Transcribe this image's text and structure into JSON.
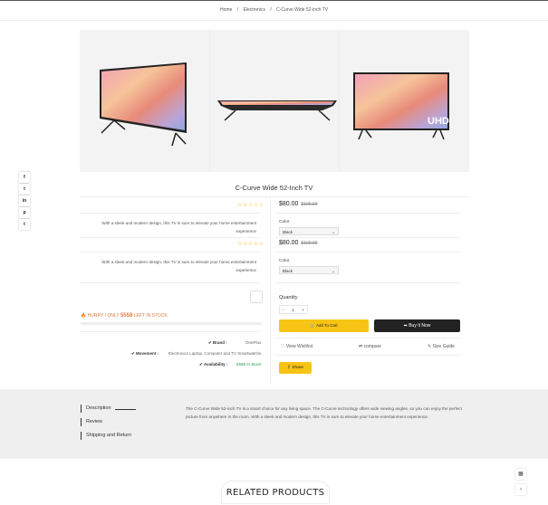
{
  "breadcrumb": {
    "home": "Home",
    "sep": "/",
    "category": "Electronics",
    "current": "C-Curve Wide 52-inch TV"
  },
  "gallery": {
    "uhd_badge": "UHD"
  },
  "social": [
    "f",
    "t",
    "in",
    "p",
    "t"
  ],
  "product": {
    "title": "C-Curve Wide 52-Inch TV",
    "stars": "☆☆☆☆☆",
    "description": "With a sleek and modern design, this TV is sure to elevate your home entertainment experience",
    "price": "$80.00",
    "old_price": "$100.00",
    "color_label": "Color",
    "color_value": "Black",
    "hurry": "HURRY ! ONLY ",
    "stock_count": "5558",
    "hurry_suffix": " LEFT IN STOCK.",
    "brand_label": "Brand :",
    "brand_value": "OnePlus",
    "movement_label": "Movement :",
    "movement_value": "Electronics Laptop, Computer and TV Smartwatche",
    "availability_label": "Availability :",
    "availability_value": "5558 In Stock"
  },
  "purchase": {
    "quantity_label": "Quantity",
    "qty_minus": "-",
    "qty_value": "1",
    "qty_plus": "+",
    "add_to_cart": "Add To Cart",
    "buy_now": "Buy It Now",
    "wishlist": "View Wishlist",
    "compare": "compare",
    "size_guide": "Size Guide",
    "share": "Share"
  },
  "tabs": {
    "items": [
      "Description",
      "Review",
      "Shipping and Return"
    ],
    "description_text": "The C-Curve Wide 52-inch TV is a smart choice for any living space. The C-Curve technology offers wide viewing angles, so you can enjoy the perfect picture from anywhere in the room. With a sleek and modern design, this TV is sure to elevate your home entertainment experience."
  },
  "related_title": "RELATED PRODUCTS",
  "colors": {
    "accent": "#f7c416",
    "dark": "#222222",
    "stars": "#f0b400",
    "hurry": "#e07a45",
    "instock": "#2a9d4a"
  }
}
